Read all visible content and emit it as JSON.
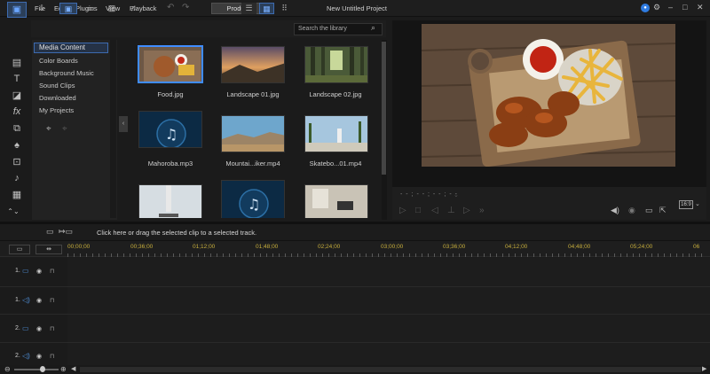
{
  "menu": {
    "logo": "✔",
    "items": [
      "File",
      "Edit",
      "Plugins",
      "View",
      "Playback"
    ],
    "produce_label": "Produce",
    "project_title": "New Untitled Project"
  },
  "library": {
    "search_placeholder": "Search the library",
    "categories": [
      "Media Content",
      "Color Boards",
      "Background Music",
      "Sound Clips",
      "Downloaded",
      "My Projects"
    ],
    "items": [
      {
        "name": "Food.jpg"
      },
      {
        "name": "Landscape 01.jpg"
      },
      {
        "name": "Landscape 02.jpg"
      },
      {
        "name": "Mahoroba.mp3"
      },
      {
        "name": "Mountai...iker.mp4"
      },
      {
        "name": "Skatebo...01.mp4"
      }
    ]
  },
  "preview": {
    "timecode": "- - ; - - ; - - ; - -"
  },
  "timeline": {
    "hint": "Click here or drag the selected clip to a selected track.",
    "ticks": [
      "00;00;00",
      "00;36;00",
      "01;12;00",
      "01;48;00",
      "02;24;00",
      "03;00;00",
      "03;36;00",
      "04;12;00",
      "04;48;00",
      "05;24;00",
      "06"
    ],
    "tracks": [
      {
        "number": "1.",
        "type": "video"
      },
      {
        "number": "1.",
        "type": "audio"
      },
      {
        "number": "2.",
        "type": "video"
      },
      {
        "number": "2.",
        "type": "audio"
      }
    ]
  },
  "colors": {
    "accent": "#3d6bb0",
    "ruler_text": "#c7ae3d",
    "selection": "#3f8cff"
  }
}
